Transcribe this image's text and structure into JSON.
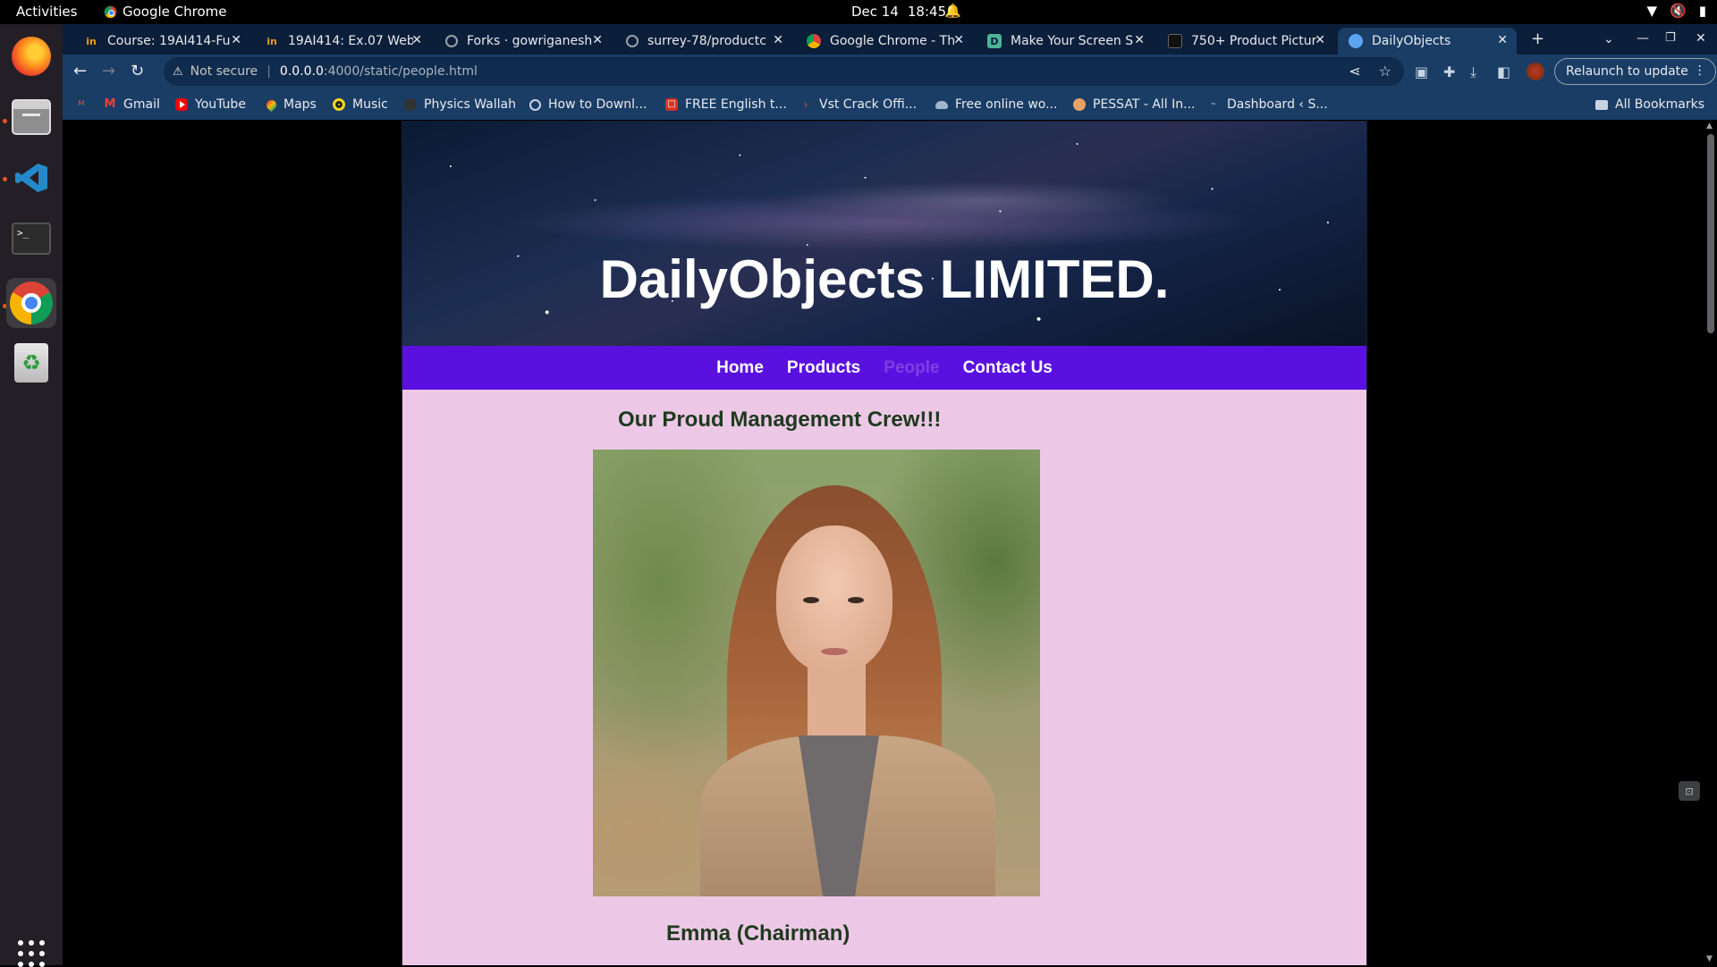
{
  "system": {
    "activities": "Activities",
    "app_name": "Google Chrome",
    "date": "Dec 14",
    "time": "18:45"
  },
  "tabs": [
    {
      "title": "Course: 19AI414-Fu",
      "icon": "in-icon"
    },
    {
      "title": "19AI414: Ex.07 Web",
      "icon": "in-icon"
    },
    {
      "title": "Forks · gowriganesh",
      "icon": "github-icon"
    },
    {
      "title": "surrey-78/productc",
      "icon": "github-icon"
    },
    {
      "title": "Google Chrome - Th",
      "icon": "chrome-icon"
    },
    {
      "title": "Make Your Screen S",
      "icon": "screenshot-icon"
    },
    {
      "title": "750+ Product Pictur",
      "icon": "product-icon"
    },
    {
      "title": "DailyObjects",
      "icon": "globe-icon"
    }
  ],
  "address_bar": {
    "security_label": "Not secure",
    "host": "0.0.0.0",
    "path": ":4000/static/people.html"
  },
  "relaunch_label": "Relaunch to update",
  "bookmarks": [
    {
      "label": "Gmail"
    },
    {
      "label": "YouTube"
    },
    {
      "label": "Maps"
    },
    {
      "label": "Music"
    },
    {
      "label": "Physics Wallah"
    },
    {
      "label": "How to Downl..."
    },
    {
      "label": "FREE English t..."
    },
    {
      "label": "Vst Crack Offi..."
    },
    {
      "label": "Free online wo..."
    },
    {
      "label": "PESSAT - All In..."
    },
    {
      "label": "Dashboard ‹ S..."
    }
  ],
  "all_bookmarks_label": "All Bookmarks",
  "page": {
    "brand_title": "DailyObjects LIMITED.",
    "nav": [
      {
        "label": "Home"
      },
      {
        "label": "Products"
      },
      {
        "label": "People"
      },
      {
        "label": "Contact Us"
      }
    ],
    "current_nav": "People",
    "section_title": "Our Proud Management Crew!!!",
    "person_name": "Emma (Chairman)"
  },
  "colors": {
    "navbar": "#5a11e0",
    "page_background": "#ecc8e6",
    "heading_text": "#1e3a1e",
    "chrome_tabstrip": "#0b1e3a",
    "chrome_toolbar": "#1a3d66"
  }
}
